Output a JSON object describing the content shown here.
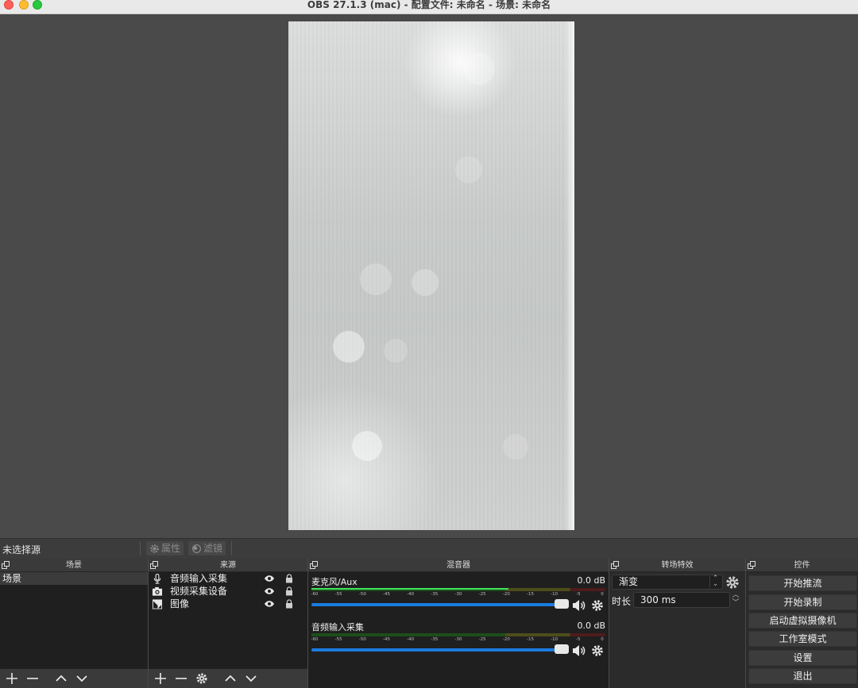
{
  "window": {
    "title": "OBS 27.1.3 (mac) - 配置文件: 未命名 - 场景: 未命名"
  },
  "source_toolbar": {
    "no_source": "未选择源",
    "properties_label": "属性",
    "filters_label": "滤镜"
  },
  "scenes": {
    "title": "场景",
    "items": [
      "场景"
    ]
  },
  "sources": {
    "title": "来源",
    "items": [
      {
        "label": "音频输入采集",
        "icon": "microphone-icon"
      },
      {
        "label": "视频采集设备",
        "icon": "camera-icon"
      },
      {
        "label": "图像",
        "icon": "image-icon"
      }
    ]
  },
  "mixer": {
    "title": "混音器",
    "ticks": [
      "-60",
      "-55",
      "-50",
      "-45",
      "-40",
      "-35",
      "-30",
      "-25",
      "-20",
      "-15",
      "-10",
      "-5",
      "0"
    ],
    "channels": [
      {
        "name": "麦克风/Aux",
        "db": "0.0 dB",
        "level": 0.67
      },
      {
        "name": "音频输入采集",
        "db": "0.0 dB",
        "level": 0
      }
    ]
  },
  "transitions": {
    "title": "转场特效",
    "selected": "渐变",
    "duration_label": "时长",
    "duration_value": "300 ms"
  },
  "controls": {
    "title": "控件",
    "buttons": [
      "开始推流",
      "开始录制",
      "启动虚拟摄像机",
      "工作室模式",
      "设置",
      "退出"
    ]
  }
}
